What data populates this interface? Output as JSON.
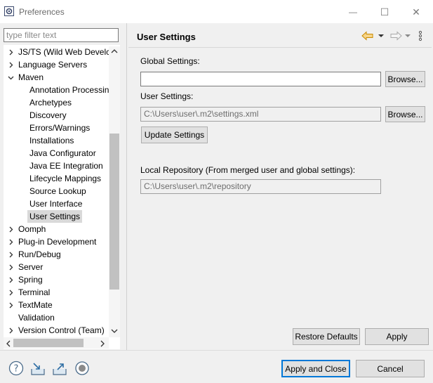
{
  "window": {
    "title": "Preferences",
    "minimize_glyph": "—",
    "maximize_glyph": "☐",
    "close_glyph": "✕"
  },
  "filter": {
    "placeholder": "type filter text",
    "value": ""
  },
  "tree": {
    "items": [
      {
        "label": "JS/TS (Wild Web Develc",
        "twisty": "collapsed",
        "level": 0
      },
      {
        "label": "Language Servers",
        "twisty": "collapsed",
        "level": 0
      },
      {
        "label": "Maven",
        "twisty": "expanded",
        "level": 0
      },
      {
        "label": "Annotation Processin",
        "level": 1
      },
      {
        "label": "Archetypes",
        "level": 1
      },
      {
        "label": "Discovery",
        "level": 1
      },
      {
        "label": "Errors/Warnings",
        "level": 1
      },
      {
        "label": "Installations",
        "level": 1
      },
      {
        "label": "Java Configurator",
        "level": 1
      },
      {
        "label": "Java EE Integration",
        "level": 1
      },
      {
        "label": "Lifecycle Mappings",
        "level": 1
      },
      {
        "label": "Source Lookup",
        "level": 1
      },
      {
        "label": "User Interface",
        "level": 1
      },
      {
        "label": "User Settings",
        "level": 1,
        "selected": true
      },
      {
        "label": "Oomph",
        "twisty": "collapsed",
        "level": 0
      },
      {
        "label": "Plug-in Development",
        "twisty": "collapsed",
        "level": 0
      },
      {
        "label": "Run/Debug",
        "twisty": "collapsed",
        "level": 0
      },
      {
        "label": "Server",
        "twisty": "collapsed",
        "level": 0
      },
      {
        "label": "Spring",
        "twisty": "collapsed",
        "level": 0
      },
      {
        "label": "Terminal",
        "twisty": "collapsed",
        "level": 0
      },
      {
        "label": "TextMate",
        "twisty": "collapsed",
        "level": 0
      },
      {
        "label": "Validation",
        "level": 0
      },
      {
        "label": "Version Control (Team)",
        "twisty": "collapsed",
        "level": 0
      }
    ]
  },
  "page": {
    "title": "User Settings",
    "global_settings_label": "Global Settings:",
    "global_settings_value": "",
    "browse_label": "Browse...",
    "user_settings_label": "User Settings:",
    "user_settings_value": "C:\\Users\\user\\.m2\\settings.xml",
    "update_settings_label": "Update Settings",
    "local_repo_label": "Local Repository (From merged user and global settings):",
    "local_repo_value": "C:\\Users\\user\\.m2\\repository",
    "restore_defaults_label": "Restore Defaults",
    "apply_label": "Apply"
  },
  "footer": {
    "apply_close_label": "Apply and Close",
    "cancel_label": "Cancel"
  },
  "colors": {
    "accent": "#0078d7",
    "selection": "#d9d9d9",
    "nav_back": "#e8a317"
  }
}
